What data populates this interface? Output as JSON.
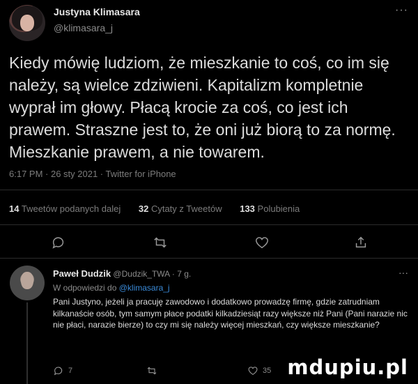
{
  "tweet": {
    "author_name": "Justyna Klimasara",
    "author_handle": "@klimasara_j",
    "more": "···",
    "text": "Kiedy mówię ludziom, że mieszkanie to coś, co im się\nnależy, są wielce zdziwieni. Kapitalizm kompletnie\nwyprał im głowy. Płacą krocie za coś, co jest ich\nprawem. Straszne jest to, że oni już biorą to za normę.\nMieszkanie prawem, a nie towarem.",
    "meta": "6:17 PM · 26 sty 2021 · Twitter for iPhone"
  },
  "stats": {
    "retweets_count": "14",
    "retweets_label": "Tweetów podanych dalej",
    "quotes_count": "32",
    "quotes_label": "Cytaty z Tweetów",
    "likes_count": "133",
    "likes_label": "Polubienia"
  },
  "actions": {
    "reply_icon": "comment-icon",
    "retweet_icon": "retweet-icon",
    "like_icon": "heart-icon",
    "share_icon": "share-icon"
  },
  "reply": {
    "author_name": "Paweł Dudzik",
    "author_handle": "@Dudzik_TWA",
    "time": "· 7 g.",
    "more": "···",
    "replying_prefix": "W odpowiedzi do ",
    "replying_to": "@klimasara_j",
    "text": "Pani Justyno, jeżeli ja pracuję zawodowo i dodatkowo prowadzę firmę, gdzie zatrudniam kilkanaście osób, tym samym płace podatki kilkadziesiąt razy większe niż Pani (Pani narazie nic nie płaci, narazie bierze) to czy mi się należy więcej mieszkań, czy większe mieszkanie?",
    "reply_count": "7",
    "like_count": "35"
  },
  "watermark": "mdupiu.pl",
  "colors": {
    "background": "#000000",
    "text": "#dcdcdc",
    "secondary": "#7c7c7c",
    "link": "#3a8ad8"
  }
}
